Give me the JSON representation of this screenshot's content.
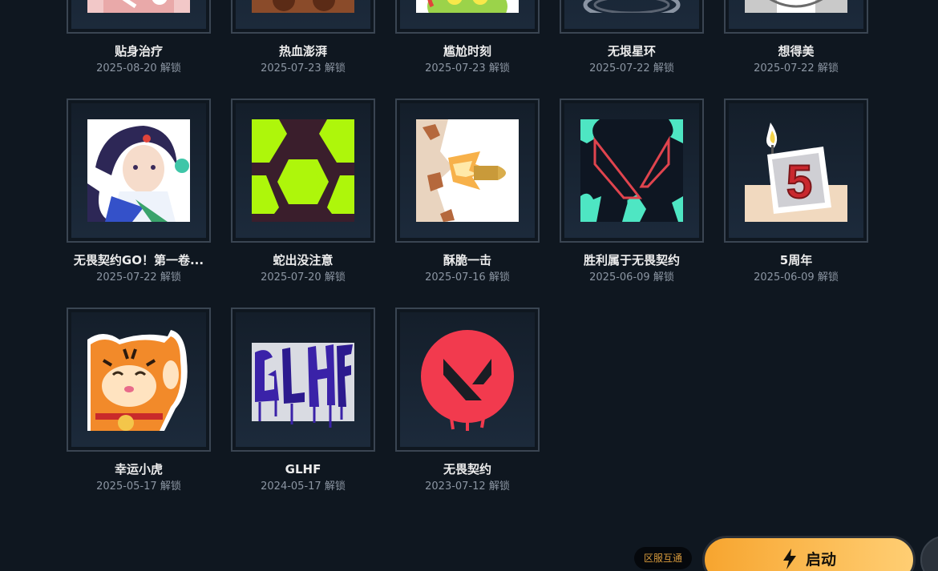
{
  "status_suffix": "解锁",
  "sprays": [
    {
      "name": "贴身治疗",
      "date": "2025-08-20",
      "art": "heal-spray-icon"
    },
    {
      "name": "热血澎湃",
      "date": "2025-07-23",
      "art": "hot-blood-spray-icon"
    },
    {
      "name": "尴尬时刻",
      "date": "2025-07-23",
      "art": "awkward-moment-spray-icon"
    },
    {
      "name": "无垠星环",
      "date": "2025-07-22",
      "art": "star-ring-spray-icon"
    },
    {
      "name": "想得美",
      "date": "2025-07-22",
      "art": "dream-on-spray-icon"
    },
    {
      "name": "无畏契约GO！第一卷...",
      "date": "2025-07-22",
      "art": "anime-girl-spray-icon"
    },
    {
      "name": "蛇出没注意",
      "date": "2025-07-20",
      "art": "snake-warning-spray-icon"
    },
    {
      "name": "酥脆一击",
      "date": "2025-07-16",
      "art": "bullet-spray-icon"
    },
    {
      "name": "胜利属于无畏契约",
      "date": "2025-06-09",
      "art": "victory-v-spray-icon"
    },
    {
      "name": "5周年",
      "date": "2025-06-09",
      "art": "fifth-anniversary-candle-icon"
    },
    {
      "name": "幸运小虎",
      "date": "2025-05-17",
      "art": "lucky-tiger-spray-icon"
    },
    {
      "name": "GLHF",
      "date": "2024-05-17",
      "art": "glhf-graffiti-spray-icon"
    },
    {
      "name": "无畏契约",
      "date": "2023-07-12",
      "art": "valorant-logo-spray-icon"
    }
  ],
  "footer": {
    "region_badge": "区服互通",
    "launch_label": "启动",
    "launch_icon": "lightning-bolt-icon"
  },
  "colors": {
    "background": "#0f1720",
    "launch_gradient_start": "#f7a52f",
    "launch_gradient_end": "#ffce73",
    "badge_text": "#d79a3c"
  }
}
